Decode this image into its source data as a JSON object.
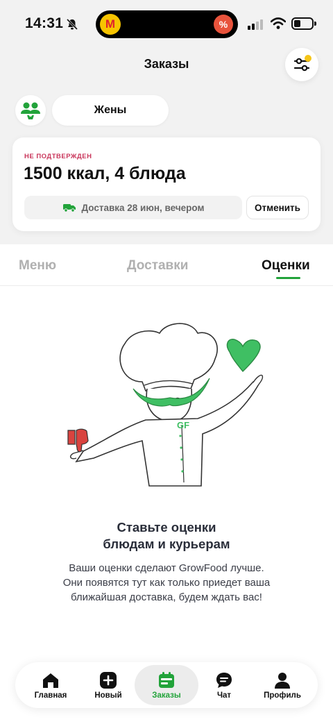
{
  "status_bar": {
    "time": "14:31",
    "island_left_glyph": "М",
    "island_right_glyph": "%"
  },
  "header": {
    "title": "Заказы"
  },
  "profile": {
    "chip_label": "Жены"
  },
  "order": {
    "status": "НЕ ПОДТВЕРЖДЕН",
    "summary": "1500 ккал, 4 блюда",
    "delivery": "Доставка 28 июн, вечером",
    "cancel_label": "Отменить"
  },
  "tabs": [
    {
      "label": "Меню",
      "active": false
    },
    {
      "label": "Доставки",
      "active": false
    },
    {
      "label": "Оценки",
      "active": true
    }
  ],
  "illustration": {
    "chef_logo": "GF"
  },
  "empty_state": {
    "title_line1": "Ставьте оценки",
    "title_line2": "блюдам и курьерам",
    "desc_line1": "Ваши оценки сделают GrowFood лучше.",
    "desc_line2": "Они появятся тут как только приедет ваша",
    "desc_line3": "ближайшая доставка, будем ждать вас!"
  },
  "bottom_nav": [
    {
      "label": "Главная",
      "icon": "home-icon",
      "active": false
    },
    {
      "label": "Новый",
      "icon": "plus-icon",
      "active": false
    },
    {
      "label": "Заказы",
      "icon": "calendar-icon",
      "active": true
    },
    {
      "label": "Чат",
      "icon": "chat-icon",
      "active": false
    },
    {
      "label": "Профиль",
      "icon": "person-icon",
      "active": false
    }
  ],
  "colors": {
    "accent_green": "#22a33a",
    "status_pink": "#c9365b",
    "heart_green": "#3fbf63",
    "thumb_red": "#d9433f",
    "filter_dot": "#f5c518"
  }
}
